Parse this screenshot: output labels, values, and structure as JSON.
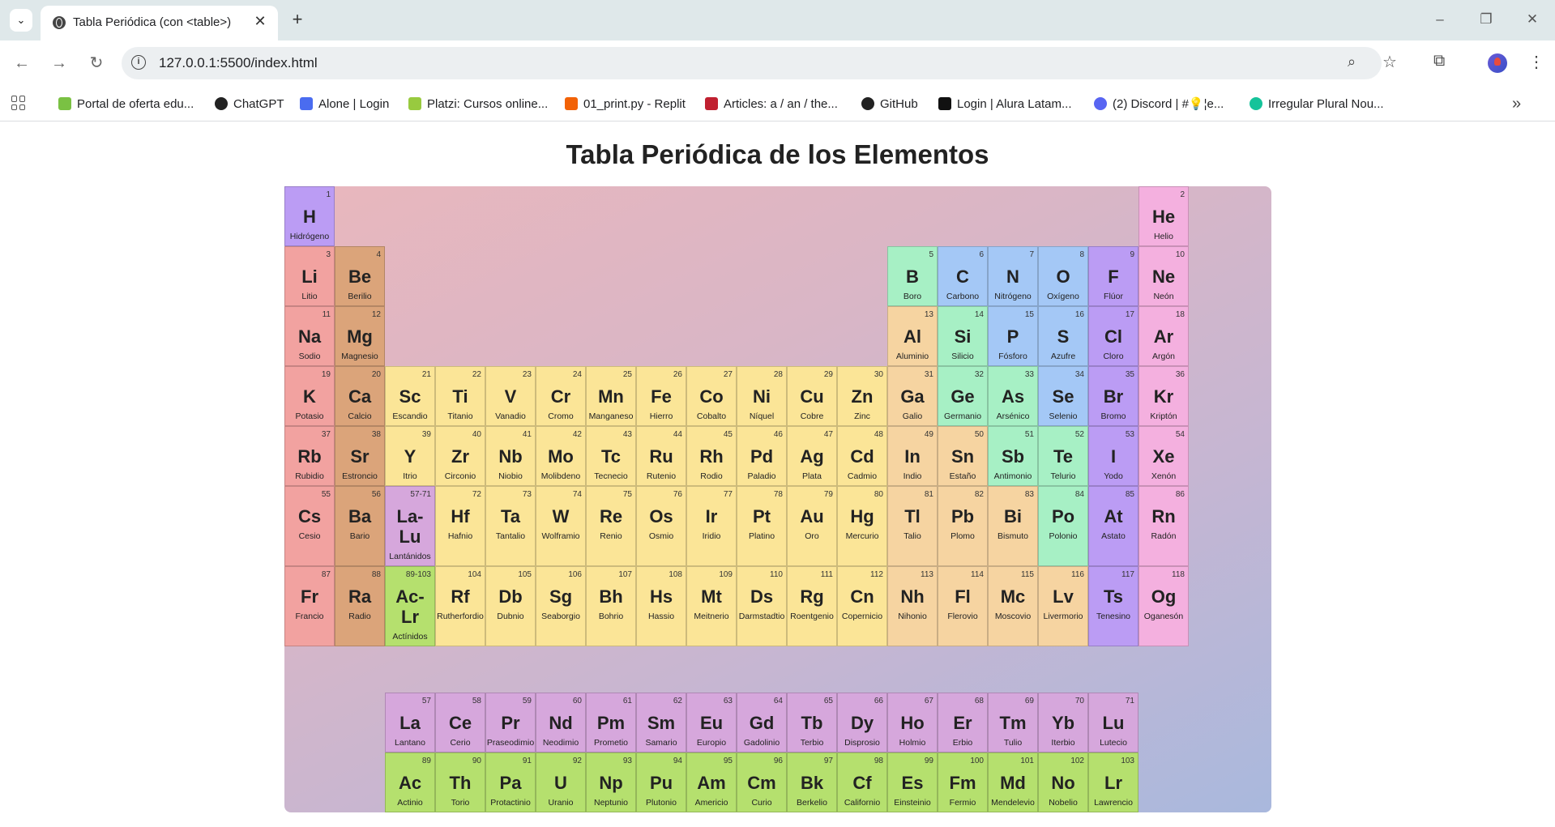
{
  "browser": {
    "tab_title": "Tabla Periódica (con <table>)",
    "url": "127.0.0.1:5500/index.html",
    "bookmarks": [
      {
        "label": "Portal de oferta edu...",
        "icon": "platzi-sp-icon",
        "color": "#7ac143"
      },
      {
        "label": "ChatGPT",
        "icon": "openai-icon",
        "color": "#222222"
      },
      {
        "label": "Alone | Login",
        "icon": "alone-icon",
        "color": "#4a6cf0"
      },
      {
        "label": "Platzi: Cursos online...",
        "icon": "platzi-icon",
        "color": "#98ca3f"
      },
      {
        "label": "01_print.py - Replit",
        "icon": "replit-icon",
        "color": "#f26207"
      },
      {
        "label": "Articles: a / an / the...",
        "icon": "article-icon",
        "color": "#c02030"
      },
      {
        "label": "GitHub",
        "icon": "github-icon",
        "color": "#222222"
      },
      {
        "label": "Login | Alura Latam...",
        "icon": "alura-icon",
        "color": "#111111"
      },
      {
        "label": "(2) Discord | #💡¦e...",
        "icon": "discord-icon",
        "color": "#5865f2"
      },
      {
        "label": "Irregular Plural Nou...",
        "icon": "grammarly-icon",
        "color": "#15c39a"
      }
    ]
  },
  "page": {
    "title": "Tabla Periódica de los Elementos"
  },
  "colors": {
    "alkali": "#f2a2a0",
    "alkaline": "#dba47a",
    "transition": "#fbe597",
    "post": "#f6d4a1",
    "metalloid": "#a7f0c5",
    "nonmetal": "#a4c8f6",
    "halogen": "#bb9cf4",
    "noble": "#f4b0df",
    "lanthanide": "#d6a7dc",
    "actinide": "#b5e06e"
  },
  "elements": [
    {
      "n": "1",
      "s": "H",
      "name": "Hidrógeno",
      "cat": "halogen",
      "row": 1,
      "col": 1
    },
    {
      "n": "2",
      "s": "He",
      "name": "Helio",
      "cat": "noble",
      "row": 1,
      "col": 18
    },
    {
      "n": "3",
      "s": "Li",
      "name": "Litio",
      "cat": "alkali",
      "row": 2,
      "col": 1
    },
    {
      "n": "4",
      "s": "Be",
      "name": "Berilio",
      "cat": "alkaline",
      "row": 2,
      "col": 2
    },
    {
      "n": "5",
      "s": "B",
      "name": "Boro",
      "cat": "metalloid",
      "row": 2,
      "col": 13
    },
    {
      "n": "6",
      "s": "C",
      "name": "Carbono",
      "cat": "nonmetal",
      "row": 2,
      "col": 14
    },
    {
      "n": "7",
      "s": "N",
      "name": "Nitrógeno",
      "cat": "nonmetal",
      "row": 2,
      "col": 15
    },
    {
      "n": "8",
      "s": "O",
      "name": "Oxígeno",
      "cat": "nonmetal",
      "row": 2,
      "col": 16
    },
    {
      "n": "9",
      "s": "F",
      "name": "Flúor",
      "cat": "halogen",
      "row": 2,
      "col": 17
    },
    {
      "n": "10",
      "s": "Ne",
      "name": "Neón",
      "cat": "noble",
      "row": 2,
      "col": 18
    },
    {
      "n": "11",
      "s": "Na",
      "name": "Sodio",
      "cat": "alkali",
      "row": 3,
      "col": 1
    },
    {
      "n": "12",
      "s": "Mg",
      "name": "Magnesio",
      "cat": "alkaline",
      "row": 3,
      "col": 2
    },
    {
      "n": "13",
      "s": "Al",
      "name": "Aluminio",
      "cat": "post",
      "row": 3,
      "col": 13
    },
    {
      "n": "14",
      "s": "Si",
      "name": "Silicio",
      "cat": "metalloid",
      "row": 3,
      "col": 14
    },
    {
      "n": "15",
      "s": "P",
      "name": "Fósforo",
      "cat": "nonmetal",
      "row": 3,
      "col": 15
    },
    {
      "n": "16",
      "s": "S",
      "name": "Azufre",
      "cat": "nonmetal",
      "row": 3,
      "col": 16
    },
    {
      "n": "17",
      "s": "Cl",
      "name": "Cloro",
      "cat": "halogen",
      "row": 3,
      "col": 17
    },
    {
      "n": "18",
      "s": "Ar",
      "name": "Argón",
      "cat": "noble",
      "row": 3,
      "col": 18
    },
    {
      "n": "19",
      "s": "K",
      "name": "Potasio",
      "cat": "alkali",
      "row": 4,
      "col": 1
    },
    {
      "n": "20",
      "s": "Ca",
      "name": "Calcio",
      "cat": "alkaline",
      "row": 4,
      "col": 2
    },
    {
      "n": "21",
      "s": "Sc",
      "name": "Escandio",
      "cat": "transition",
      "row": 4,
      "col": 3
    },
    {
      "n": "22",
      "s": "Ti",
      "name": "Titanio",
      "cat": "transition",
      "row": 4,
      "col": 4
    },
    {
      "n": "23",
      "s": "V",
      "name": "Vanadio",
      "cat": "transition",
      "row": 4,
      "col": 5
    },
    {
      "n": "24",
      "s": "Cr",
      "name": "Cromo",
      "cat": "transition",
      "row": 4,
      "col": 6
    },
    {
      "n": "25",
      "s": "Mn",
      "name": "Manganeso",
      "cat": "transition",
      "row": 4,
      "col": 7
    },
    {
      "n": "26",
      "s": "Fe",
      "name": "Hierro",
      "cat": "transition",
      "row": 4,
      "col": 8
    },
    {
      "n": "27",
      "s": "Co",
      "name": "Cobalto",
      "cat": "transition",
      "row": 4,
      "col": 9
    },
    {
      "n": "28",
      "s": "Ni",
      "name": "Níquel",
      "cat": "transition",
      "row": 4,
      "col": 10
    },
    {
      "n": "29",
      "s": "Cu",
      "name": "Cobre",
      "cat": "transition",
      "row": 4,
      "col": 11
    },
    {
      "n": "30",
      "s": "Zn",
      "name": "Zinc",
      "cat": "transition",
      "row": 4,
      "col": 12
    },
    {
      "n": "31",
      "s": "Ga",
      "name": "Galio",
      "cat": "post",
      "row": 4,
      "col": 13
    },
    {
      "n": "32",
      "s": "Ge",
      "name": "Germanio",
      "cat": "metalloid",
      "row": 4,
      "col": 14
    },
    {
      "n": "33",
      "s": "As",
      "name": "Arsénico",
      "cat": "metalloid",
      "row": 4,
      "col": 15
    },
    {
      "n": "34",
      "s": "Se",
      "name": "Selenio",
      "cat": "nonmetal",
      "row": 4,
      "col": 16
    },
    {
      "n": "35",
      "s": "Br",
      "name": "Bromo",
      "cat": "halogen",
      "row": 4,
      "col": 17
    },
    {
      "n": "36",
      "s": "Kr",
      "name": "Kriptón",
      "cat": "noble",
      "row": 4,
      "col": 18
    },
    {
      "n": "37",
      "s": "Rb",
      "name": "Rubidio",
      "cat": "alkali",
      "row": 5,
      "col": 1
    },
    {
      "n": "38",
      "s": "Sr",
      "name": "Estroncio",
      "cat": "alkaline",
      "row": 5,
      "col": 2
    },
    {
      "n": "39",
      "s": "Y",
      "name": "Itrio",
      "cat": "transition",
      "row": 5,
      "col": 3
    },
    {
      "n": "40",
      "s": "Zr",
      "name": "Circonio",
      "cat": "transition",
      "row": 5,
      "col": 4
    },
    {
      "n": "41",
      "s": "Nb",
      "name": "Niobio",
      "cat": "transition",
      "row": 5,
      "col": 5
    },
    {
      "n": "42",
      "s": "Mo",
      "name": "Molibdeno",
      "cat": "transition",
      "row": 5,
      "col": 6
    },
    {
      "n": "43",
      "s": "Tc",
      "name": "Tecnecio",
      "cat": "transition",
      "row": 5,
      "col": 7
    },
    {
      "n": "44",
      "s": "Ru",
      "name": "Rutenio",
      "cat": "transition",
      "row": 5,
      "col": 8
    },
    {
      "n": "45",
      "s": "Rh",
      "name": "Rodio",
      "cat": "transition",
      "row": 5,
      "col": 9
    },
    {
      "n": "46",
      "s": "Pd",
      "name": "Paladio",
      "cat": "transition",
      "row": 5,
      "col": 10
    },
    {
      "n": "47",
      "s": "Ag",
      "name": "Plata",
      "cat": "transition",
      "row": 5,
      "col": 11
    },
    {
      "n": "48",
      "s": "Cd",
      "name": "Cadmio",
      "cat": "transition",
      "row": 5,
      "col": 12
    },
    {
      "n": "49",
      "s": "In",
      "name": "Indio",
      "cat": "post",
      "row": 5,
      "col": 13
    },
    {
      "n": "50",
      "s": "Sn",
      "name": "Estaño",
      "cat": "post",
      "row": 5,
      "col": 14
    },
    {
      "n": "51",
      "s": "Sb",
      "name": "Antimonio",
      "cat": "metalloid",
      "row": 5,
      "col": 15
    },
    {
      "n": "52",
      "s": "Te",
      "name": "Telurio",
      "cat": "metalloid",
      "row": 5,
      "col": 16
    },
    {
      "n": "53",
      "s": "I",
      "name": "Yodo",
      "cat": "halogen",
      "row": 5,
      "col": 17
    },
    {
      "n": "54",
      "s": "Xe",
      "name": "Xenón",
      "cat": "noble",
      "row": 5,
      "col": 18
    },
    {
      "n": "55",
      "s": "Cs",
      "name": "Cesio",
      "cat": "alkali",
      "row": 6,
      "col": 1
    },
    {
      "n": "56",
      "s": "Ba",
      "name": "Bario",
      "cat": "alkaline",
      "row": 6,
      "col": 2
    },
    {
      "n": "57-71",
      "s": "La-Lu",
      "name": "Lantánidos",
      "cat": "lanth",
      "row": 6,
      "col": 3,
      "split": true
    },
    {
      "n": "72",
      "s": "Hf",
      "name": "Hafnio",
      "cat": "transition",
      "row": 6,
      "col": 4
    },
    {
      "n": "73",
      "s": "Ta",
      "name": "Tantalio",
      "cat": "transition",
      "row": 6,
      "col": 5
    },
    {
      "n": "74",
      "s": "W",
      "name": "Wolframio",
      "cat": "transition",
      "row": 6,
      "col": 6
    },
    {
      "n": "75",
      "s": "Re",
      "name": "Renio",
      "cat": "transition",
      "row": 6,
      "col": 7
    },
    {
      "n": "76",
      "s": "Os",
      "name": "Osmio",
      "cat": "transition",
      "row": 6,
      "col": 8
    },
    {
      "n": "77",
      "s": "Ir",
      "name": "Iridio",
      "cat": "transition",
      "row": 6,
      "col": 9
    },
    {
      "n": "78",
      "s": "Pt",
      "name": "Platino",
      "cat": "transition",
      "row": 6,
      "col": 10
    },
    {
      "n": "79",
      "s": "Au",
      "name": "Oro",
      "cat": "transition",
      "row": 6,
      "col": 11
    },
    {
      "n": "80",
      "s": "Hg",
      "name": "Mercurio",
      "cat": "transition",
      "row": 6,
      "col": 12
    },
    {
      "n": "81",
      "s": "Tl",
      "name": "Talio",
      "cat": "post",
      "row": 6,
      "col": 13
    },
    {
      "n": "82",
      "s": "Pb",
      "name": "Plomo",
      "cat": "post",
      "row": 6,
      "col": 14
    },
    {
      "n": "83",
      "s": "Bi",
      "name": "Bismuto",
      "cat": "post",
      "row": 6,
      "col": 15
    },
    {
      "n": "84",
      "s": "Po",
      "name": "Polonio",
      "cat": "metalloid",
      "row": 6,
      "col": 16
    },
    {
      "n": "85",
      "s": "At",
      "name": "Astato",
      "cat": "halogen",
      "row": 6,
      "col": 17
    },
    {
      "n": "86",
      "s": "Rn",
      "name": "Radón",
      "cat": "noble",
      "row": 6,
      "col": 18
    },
    {
      "n": "87",
      "s": "Fr",
      "name": "Francio",
      "cat": "alkali",
      "row": 7,
      "col": 1
    },
    {
      "n": "88",
      "s": "Ra",
      "name": "Radio",
      "cat": "alkaline",
      "row": 7,
      "col": 2
    },
    {
      "n": "89-103",
      "s": "Ac-Lr",
      "name": "Actínidos",
      "cat": "actin",
      "row": 7,
      "col": 3,
      "split": true
    },
    {
      "n": "104",
      "s": "Rf",
      "name": "Rutherfordio",
      "cat": "transition",
      "row": 7,
      "col": 4
    },
    {
      "n": "105",
      "s": "Db",
      "name": "Dubnio",
      "cat": "transition",
      "row": 7,
      "col": 5
    },
    {
      "n": "106",
      "s": "Sg",
      "name": "Seaborgio",
      "cat": "transition",
      "row": 7,
      "col": 6
    },
    {
      "n": "107",
      "s": "Bh",
      "name": "Bohrio",
      "cat": "transition",
      "row": 7,
      "col": 7
    },
    {
      "n": "108",
      "s": "Hs",
      "name": "Hassio",
      "cat": "transition",
      "row": 7,
      "col": 8
    },
    {
      "n": "109",
      "s": "Mt",
      "name": "Meitnerio",
      "cat": "transition",
      "row": 7,
      "col": 9
    },
    {
      "n": "110",
      "s": "Ds",
      "name": "Darmstadtio",
      "cat": "transition",
      "row": 7,
      "col": 10
    },
    {
      "n": "111",
      "s": "Rg",
      "name": "Roentgenio",
      "cat": "transition",
      "row": 7,
      "col": 11
    },
    {
      "n": "112",
      "s": "Cn",
      "name": "Copernicio",
      "cat": "transition",
      "row": 7,
      "col": 12
    },
    {
      "n": "113",
      "s": "Nh",
      "name": "Nihonio",
      "cat": "post",
      "row": 7,
      "col": 13
    },
    {
      "n": "114",
      "s": "Fl",
      "name": "Flerovio",
      "cat": "post",
      "row": 7,
      "col": 14
    },
    {
      "n": "115",
      "s": "Mc",
      "name": "Moscovio",
      "cat": "post",
      "row": 7,
      "col": 15
    },
    {
      "n": "116",
      "s": "Lv",
      "name": "Livermorio",
      "cat": "post",
      "row": 7,
      "col": 16
    },
    {
      "n": "117",
      "s": "Ts",
      "name": "Tenesino",
      "cat": "halogen",
      "row": 7,
      "col": 17
    },
    {
      "n": "118",
      "s": "Og",
      "name": "Oganesón",
      "cat": "noble",
      "row": 7,
      "col": 18
    },
    {
      "n": "57",
      "s": "La",
      "name": "Lantano",
      "cat": "lanth",
      "row": 9,
      "col": 3
    },
    {
      "n": "58",
      "s": "Ce",
      "name": "Cerio",
      "cat": "lanth",
      "row": 9,
      "col": 4
    },
    {
      "n": "59",
      "s": "Pr",
      "name": "Praseodimio",
      "cat": "lanth",
      "row": 9,
      "col": 5
    },
    {
      "n": "60",
      "s": "Nd",
      "name": "Neodimio",
      "cat": "lanth",
      "row": 9,
      "col": 6
    },
    {
      "n": "61",
      "s": "Pm",
      "name": "Prometio",
      "cat": "lanth",
      "row": 9,
      "col": 7
    },
    {
      "n": "62",
      "s": "Sm",
      "name": "Samario",
      "cat": "lanth",
      "row": 9,
      "col": 8
    },
    {
      "n": "63",
      "s": "Eu",
      "name": "Europio",
      "cat": "lanth",
      "row": 9,
      "col": 9
    },
    {
      "n": "64",
      "s": "Gd",
      "name": "Gadolinio",
      "cat": "lanth",
      "row": 9,
      "col": 10
    },
    {
      "n": "65",
      "s": "Tb",
      "name": "Terbio",
      "cat": "lanth",
      "row": 9,
      "col": 11
    },
    {
      "n": "66",
      "s": "Dy",
      "name": "Disprosio",
      "cat": "lanth",
      "row": 9,
      "col": 12
    },
    {
      "n": "67",
      "s": "Ho",
      "name": "Holmio",
      "cat": "lanth",
      "row": 9,
      "col": 13
    },
    {
      "n": "68",
      "s": "Er",
      "name": "Erbio",
      "cat": "lanth",
      "row": 9,
      "col": 14
    },
    {
      "n": "69",
      "s": "Tm",
      "name": "Tulio",
      "cat": "lanth",
      "row": 9,
      "col": 15
    },
    {
      "n": "70",
      "s": "Yb",
      "name": "Iterbio",
      "cat": "lanth",
      "row": 9,
      "col": 16
    },
    {
      "n": "71",
      "s": "Lu",
      "name": "Lutecio",
      "cat": "lanth",
      "row": 9,
      "col": 17
    },
    {
      "n": "89",
      "s": "Ac",
      "name": "Actinio",
      "cat": "actin",
      "row": 10,
      "col": 3
    },
    {
      "n": "90",
      "s": "Th",
      "name": "Torio",
      "cat": "actin",
      "row": 10,
      "col": 4
    },
    {
      "n": "91",
      "s": "Pa",
      "name": "Protactinio",
      "cat": "actin",
      "row": 10,
      "col": 5
    },
    {
      "n": "92",
      "s": "U",
      "name": "Uranio",
      "cat": "actin",
      "row": 10,
      "col": 6
    },
    {
      "n": "93",
      "s": "Np",
      "name": "Neptunio",
      "cat": "actin",
      "row": 10,
      "col": 7
    },
    {
      "n": "94",
      "s": "Pu",
      "name": "Plutonio",
      "cat": "actin",
      "row": 10,
      "col": 8
    },
    {
      "n": "95",
      "s": "Am",
      "name": "Americio",
      "cat": "actin",
      "row": 10,
      "col": 9
    },
    {
      "n": "96",
      "s": "Cm",
      "name": "Curio",
      "cat": "actin",
      "row": 10,
      "col": 10
    },
    {
      "n": "97",
      "s": "Bk",
      "name": "Berkelio",
      "cat": "actin",
      "row": 10,
      "col": 11
    },
    {
      "n": "98",
      "s": "Cf",
      "name": "Californio",
      "cat": "actin",
      "row": 10,
      "col": 12
    },
    {
      "n": "99",
      "s": "Es",
      "name": "Einsteinio",
      "cat": "actin",
      "row": 10,
      "col": 13
    },
    {
      "n": "100",
      "s": "Fm",
      "name": "Fermio",
      "cat": "actin",
      "row": 10,
      "col": 14
    },
    {
      "n": "101",
      "s": "Md",
      "name": "Mendelevio",
      "cat": "actin",
      "row": 10,
      "col": 15
    },
    {
      "n": "102",
      "s": "No",
      "name": "Nobelio",
      "cat": "actin",
      "row": 10,
      "col": 16
    },
    {
      "n": "103",
      "s": "Lr",
      "name": "Lawrencio",
      "cat": "actin",
      "row": 10,
      "col": 17
    }
  ]
}
